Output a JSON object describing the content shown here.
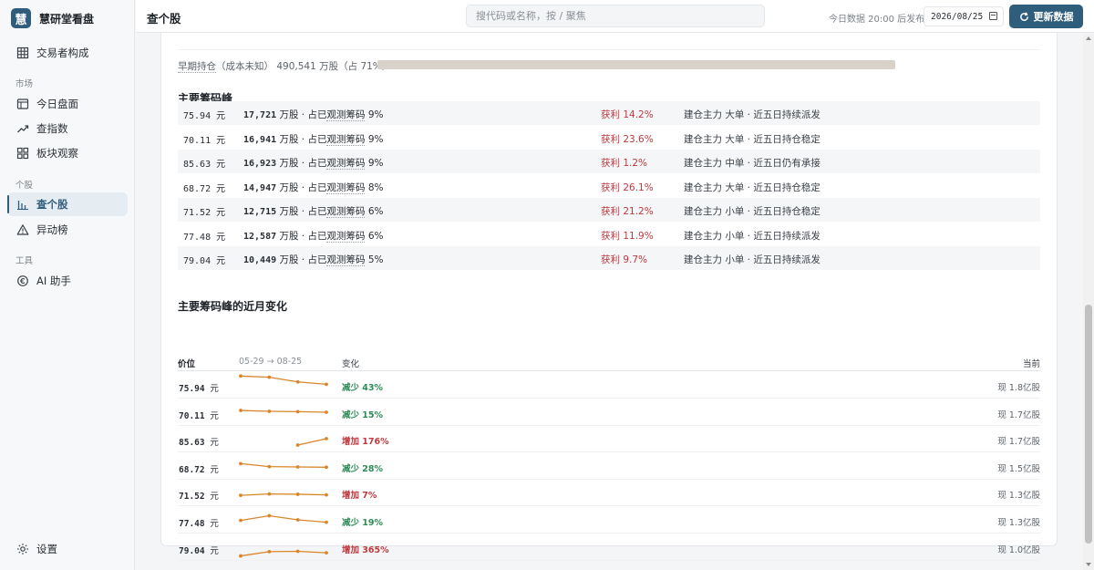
{
  "brand": {
    "logo_char": "慧",
    "title": "慧研堂看盘"
  },
  "nav": {
    "traders": "交易者构成",
    "group_market": "市场",
    "today": "今日盘面",
    "index": "查指数",
    "sector": "板块观察",
    "group_stock": "个股",
    "stock": "查个股",
    "movers": "异动榜",
    "group_tools": "工具",
    "ai": "AI 助手",
    "settings": "设置"
  },
  "topbar": {
    "title": "查个股",
    "search_placeholder": "搜代码或名称，按 / 聚焦",
    "publish_note": "今日数据 20:00 后发布",
    "date": "2026/08/25",
    "refresh_label": "更新数据"
  },
  "early": {
    "label": "早期持仓",
    "note": "（成本未知）",
    "value": "490,541 万股（占 71%）",
    "share": 0.71
  },
  "peaks": {
    "title_prefix": "主要",
    "title_term": "筹码峰",
    "rows": [
      {
        "price": "75.94",
        "yuan": "元",
        "shares": "17,721",
        "unit": "万股 · 占已",
        "obs": "观测筹码",
        "pct": "9%",
        "profit": "获利 14.2%",
        "desc": "建仓主力 大单 · 近五日持续派发"
      },
      {
        "price": "70.11",
        "yuan": "元",
        "shares": "16,941",
        "unit": "万股 · 占已",
        "obs": "观测筹码",
        "pct": "9%",
        "profit": "获利 23.6%",
        "desc": "建仓主力 大单 · 近五日持仓稳定"
      },
      {
        "price": "85.63",
        "yuan": "元",
        "shares": "16,923",
        "unit": "万股 · 占已",
        "obs": "观测筹码",
        "pct": "9%",
        "profit": "获利 1.2%",
        "desc": "建仓主力 中单 · 近五日仍有承接"
      },
      {
        "price": "68.72",
        "yuan": "元",
        "shares": "14,947",
        "unit": "万股 · 占已",
        "obs": "观测筹码",
        "pct": "8%",
        "profit": "获利 26.1%",
        "desc": "建仓主力 大单 · 近五日持仓稳定"
      },
      {
        "price": "71.52",
        "yuan": "元",
        "shares": "12,715",
        "unit": "万股 · 占已",
        "obs": "观测筹码",
        "pct": "6%",
        "profit": "获利 21.2%",
        "desc": "建仓主力 小单 · 近五日持仓稳定"
      },
      {
        "price": "77.48",
        "yuan": "元",
        "shares": "12,587",
        "unit": "万股 · 占已",
        "obs": "观测筹码",
        "pct": "6%",
        "profit": "获利 11.9%",
        "desc": "建仓主力 小单 · 近五日持续派发"
      },
      {
        "price": "79.04",
        "yuan": "元",
        "shares": "10,449",
        "unit": "万股 · 占已",
        "obs": "观测筹码",
        "pct": "5%",
        "profit": "获利 9.7%",
        "desc": "建仓主力 小单 · 近五日持续派发"
      }
    ]
  },
  "changes": {
    "title": "主要筹码峰的近月变化",
    "col_price": "价位",
    "col_range": "05-29 → 08-25",
    "col_change": "变化",
    "col_current": "当前",
    "line_color": "#d9862b",
    "rows": [
      {
        "price": "75.94",
        "yuan": "元",
        "change": "减少 43%",
        "dir": "dec",
        "current": "现 1.8亿股",
        "trend": [
          3.2,
          3.0,
          2.2,
          1.8
        ]
      },
      {
        "price": "70.11",
        "yuan": "元",
        "change": "减少 15%",
        "dir": "dec",
        "current": "现 1.7亿股",
        "trend": [
          2.0,
          1.85,
          1.8,
          1.7
        ]
      },
      {
        "price": "85.63",
        "yuan": "元",
        "change": "增加 176%",
        "dir": "inc",
        "current": "现 1.7亿股",
        "trend": [
          null,
          null,
          0.62,
          1.7
        ]
      },
      {
        "price": "68.72",
        "yuan": "元",
        "change": "减少 28%",
        "dir": "dec",
        "current": "现 1.5亿股",
        "trend": [
          2.1,
          1.6,
          1.55,
          1.5
        ]
      },
      {
        "price": "71.52",
        "yuan": "元",
        "change": "增加 7%",
        "dir": "inc",
        "current": "现 1.3亿股",
        "trend": [
          1.22,
          1.45,
          1.4,
          1.3
        ]
      },
      {
        "price": "77.48",
        "yuan": "元",
        "change": "减少 19%",
        "dir": "dec",
        "current": "现 1.3亿股",
        "trend": [
          1.6,
          2.4,
          1.7,
          1.3
        ]
      },
      {
        "price": "79.04",
        "yuan": "元",
        "change": "增加 365%",
        "dir": "inc",
        "current": "现 1.0亿股",
        "trend": [
          0.22,
          0.95,
          1.0,
          0.75
        ]
      }
    ]
  }
}
